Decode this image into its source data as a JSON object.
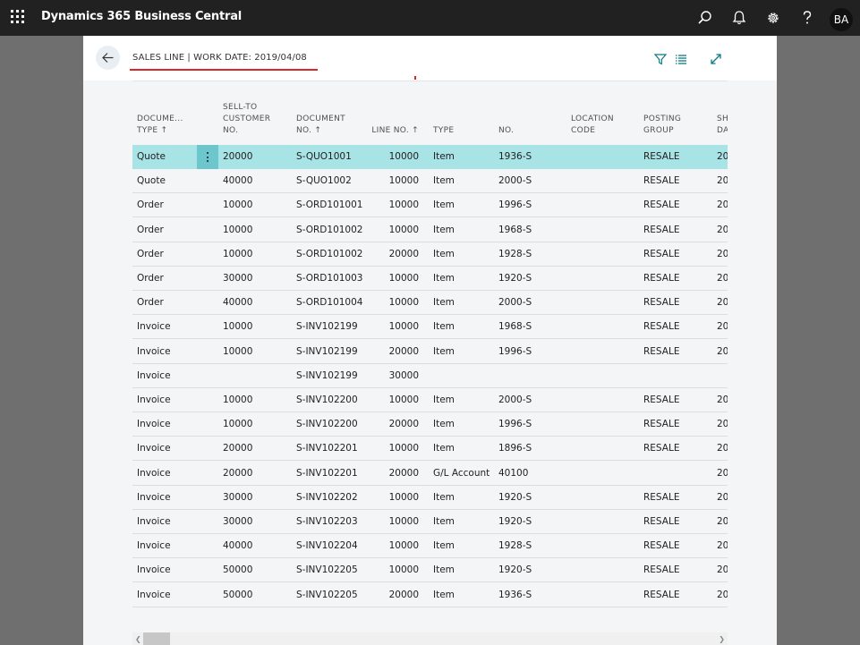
{
  "app": {
    "title": "Dynamics 365 Business Central",
    "avatar_initials": "BA",
    "icons": [
      "waffle-icon",
      "search-icon",
      "bell-icon",
      "gear-icon",
      "help-icon"
    ]
  },
  "dialog": {
    "caption": "SALES LINE | WORK DATE: 2019/04/08",
    "icons": [
      "back-arrow-icon",
      "filter-icon",
      "list-icon",
      "expand-icon"
    ],
    "accent_color": "#d9262a",
    "selected_row_color": "#a8e3e5"
  },
  "table": {
    "columns": [
      {
        "key": "doc_type",
        "lines": [
          "DOCUME...",
          "TYPE ↑"
        ]
      },
      {
        "key": "customer",
        "lines": [
          "SELL-TO",
          "CUSTOMER",
          "NO."
        ]
      },
      {
        "key": "doc_no",
        "lines": [
          "DOCUMENT",
          "NO. ↑"
        ]
      },
      {
        "key": "line_no",
        "lines": [
          "LINE NO. ↑"
        ]
      },
      {
        "key": "type",
        "lines": [
          "TYPE"
        ]
      },
      {
        "key": "no",
        "lines": [
          "NO."
        ]
      },
      {
        "key": "location",
        "lines": [
          "LOCATION",
          "CODE"
        ]
      },
      {
        "key": "posting_group",
        "lines": [
          "POSTING",
          "GROUP"
        ]
      },
      {
        "key": "shipment_date",
        "lines": [
          "SH",
          "DA"
        ]
      }
    ],
    "rows": [
      {
        "doc_type": "Quote",
        "customer": "20000",
        "doc_no": "S-QUO1001",
        "line_no": "10000",
        "type": "Item",
        "no": "1936-S",
        "location": "",
        "posting_group": "RESALE",
        "shipment_date": "20"
      },
      {
        "doc_type": "Quote",
        "customer": "40000",
        "doc_no": "S-QUO1002",
        "line_no": "10000",
        "type": "Item",
        "no": "2000-S",
        "location": "",
        "posting_group": "RESALE",
        "shipment_date": "20"
      },
      {
        "doc_type": "Order",
        "customer": "10000",
        "doc_no": "S-ORD101001",
        "line_no": "10000",
        "type": "Item",
        "no": "1996-S",
        "location": "",
        "posting_group": "RESALE",
        "shipment_date": "20"
      },
      {
        "doc_type": "Order",
        "customer": "10000",
        "doc_no": "S-ORD101002",
        "line_no": "10000",
        "type": "Item",
        "no": "1968-S",
        "location": "",
        "posting_group": "RESALE",
        "shipment_date": "20"
      },
      {
        "doc_type": "Order",
        "customer": "10000",
        "doc_no": "S-ORD101002",
        "line_no": "20000",
        "type": "Item",
        "no": "1928-S",
        "location": "",
        "posting_group": "RESALE",
        "shipment_date": "20"
      },
      {
        "doc_type": "Order",
        "customer": "30000",
        "doc_no": "S-ORD101003",
        "line_no": "10000",
        "type": "Item",
        "no": "1920-S",
        "location": "",
        "posting_group": "RESALE",
        "shipment_date": "20"
      },
      {
        "doc_type": "Order",
        "customer": "40000",
        "doc_no": "S-ORD101004",
        "line_no": "10000",
        "type": "Item",
        "no": "2000-S",
        "location": "",
        "posting_group": "RESALE",
        "shipment_date": "20"
      },
      {
        "doc_type": "Invoice",
        "customer": "10000",
        "doc_no": "S-INV102199",
        "line_no": "10000",
        "type": "Item",
        "no": "1968-S",
        "location": "",
        "posting_group": "RESALE",
        "shipment_date": "20"
      },
      {
        "doc_type": "Invoice",
        "customer": "10000",
        "doc_no": "S-INV102199",
        "line_no": "20000",
        "type": "Item",
        "no": "1996-S",
        "location": "",
        "posting_group": "RESALE",
        "shipment_date": "20"
      },
      {
        "doc_type": "Invoice",
        "customer": "",
        "doc_no": "S-INV102199",
        "line_no": "30000",
        "type": "",
        "no": "",
        "location": "",
        "posting_group": "",
        "shipment_date": ""
      },
      {
        "doc_type": "Invoice",
        "customer": "10000",
        "doc_no": "S-INV102200",
        "line_no": "10000",
        "type": "Item",
        "no": "2000-S",
        "location": "",
        "posting_group": "RESALE",
        "shipment_date": "20"
      },
      {
        "doc_type": "Invoice",
        "customer": "10000",
        "doc_no": "S-INV102200",
        "line_no": "20000",
        "type": "Item",
        "no": "1996-S",
        "location": "",
        "posting_group": "RESALE",
        "shipment_date": "20"
      },
      {
        "doc_type": "Invoice",
        "customer": "20000",
        "doc_no": "S-INV102201",
        "line_no": "10000",
        "type": "Item",
        "no": "1896-S",
        "location": "",
        "posting_group": "RESALE",
        "shipment_date": "20"
      },
      {
        "doc_type": "Invoice",
        "customer": "20000",
        "doc_no": "S-INV102201",
        "line_no": "20000",
        "type": "G/L Account",
        "no": "40100",
        "location": "",
        "posting_group": "",
        "shipment_date": "20"
      },
      {
        "doc_type": "Invoice",
        "customer": "30000",
        "doc_no": "S-INV102202",
        "line_no": "10000",
        "type": "Item",
        "no": "1920-S",
        "location": "",
        "posting_group": "RESALE",
        "shipment_date": "20"
      },
      {
        "doc_type": "Invoice",
        "customer": "30000",
        "doc_no": "S-INV102203",
        "line_no": "10000",
        "type": "Item",
        "no": "1920-S",
        "location": "",
        "posting_group": "RESALE",
        "shipment_date": "20"
      },
      {
        "doc_type": "Invoice",
        "customer": "40000",
        "doc_no": "S-INV102204",
        "line_no": "10000",
        "type": "Item",
        "no": "1928-S",
        "location": "",
        "posting_group": "RESALE",
        "shipment_date": "20"
      },
      {
        "doc_type": "Invoice",
        "customer": "50000",
        "doc_no": "S-INV102205",
        "line_no": "10000",
        "type": "Item",
        "no": "1920-S",
        "location": "",
        "posting_group": "RESALE",
        "shipment_date": "20"
      },
      {
        "doc_type": "Invoice",
        "customer": "50000",
        "doc_no": "S-INV102205",
        "line_no": "20000",
        "type": "Item",
        "no": "1936-S",
        "location": "",
        "posting_group": "RESALE",
        "shipment_date": "20"
      }
    ],
    "selected_row": 0
  }
}
